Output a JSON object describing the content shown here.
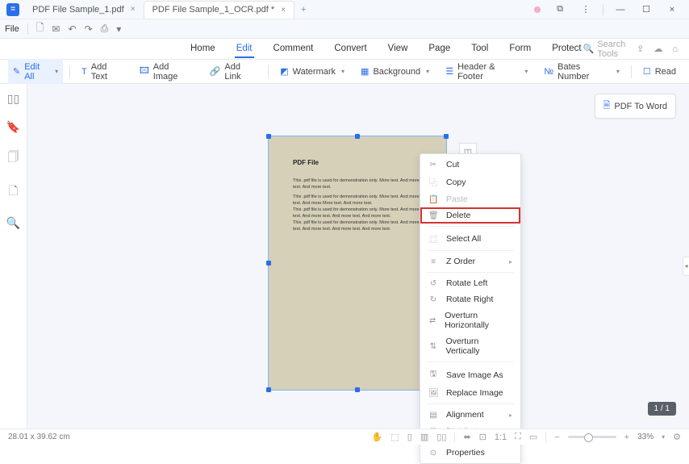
{
  "titlebar": {
    "app_glyph": "=",
    "tab1": "PDF File Sample_1.pdf",
    "tab2": "PDF File Sample_1_OCR.pdf *",
    "close": "×",
    "add": "+"
  },
  "filebar": {
    "file": "File"
  },
  "menubar": {
    "items": [
      "Home",
      "Edit",
      "Comment",
      "Convert",
      "View",
      "Page",
      "Tool",
      "Form",
      "Protect"
    ],
    "active_index": 1,
    "search_placeholder": "Search Tools"
  },
  "toolbar": {
    "edit_all": "Edit All",
    "add_text": "Add Text",
    "add_image": "Add Image",
    "add_link": "Add Link",
    "watermark": "Watermark",
    "background": "Background",
    "header_footer": "Header & Footer",
    "bates_number": "Bates Number",
    "read": "Read"
  },
  "pdf_to_word": "PDF To Word",
  "document": {
    "title": "PDF File",
    "p1": "This .pdf file is used for demonstration only. More text. And more text. And more text.",
    "p2": "This .pdf file is used for demonstration only. More text. And more text. And more More text. And more text.",
    "p3": "This .pdf file is used for demonstration only. More text. And more text. And more text. And more text. And more text.",
    "p4": "This .pdf file is used for demonstration only. More text. And more text. And more text. And more text. And more text."
  },
  "context_menu": {
    "cut": "Cut",
    "copy": "Copy",
    "paste": "Paste",
    "delete": "Delete",
    "select_all": "Select All",
    "z_order": "Z Order",
    "rotate_left": "Rotate Left",
    "rotate_right": "Rotate Right",
    "overturn_horizontally": "Overturn Horizontally",
    "overturn_vertically": "Overturn Vertically",
    "save_image_as": "Save Image As",
    "replace_image": "Replace Image",
    "alignment": "Alignment",
    "distribute": "Distribute",
    "properties": "Properties"
  },
  "status": {
    "dimensions": "28.01 x 39.62 cm",
    "page": "1 / 1",
    "zoom": "33%"
  }
}
